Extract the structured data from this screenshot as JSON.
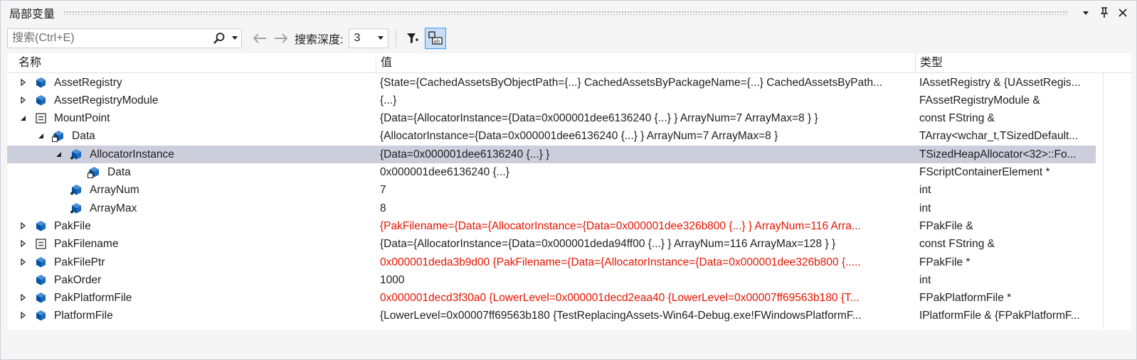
{
  "window": {
    "title": "局部变量"
  },
  "toolbar": {
    "search_placeholder": "搜索(Ctrl+E)",
    "depth_label": "搜索深度:",
    "depth_value": "3"
  },
  "columns": {
    "name": "名称",
    "value": "值",
    "type": "类型"
  },
  "rows": [
    {
      "name": "AssetRegistry",
      "value": "{State={CachedAssetsByObjectPath={...} CachedAssetsByPackageName={...} CachedAssetsByPath...",
      "type": "IAssetRegistry & {UAssetRegis...",
      "depth": 0,
      "expander": "collapsed",
      "icon": "class-member-icon",
      "value_red": false,
      "selected": false
    },
    {
      "name": "AssetRegistryModule",
      "value": "{...}",
      "type": "FAssetRegistryModule &",
      "depth": 0,
      "expander": "collapsed",
      "icon": "class-member-icon",
      "value_red": false,
      "selected": false
    },
    {
      "name": "MountPoint",
      "value": "{Data={AllocatorInstance={Data=0x000001dee6136240 {...} } ArrayNum=7 ArrayMax=8 } }",
      "type": "const FString &",
      "depth": 0,
      "expander": "expanded",
      "icon": "structure-icon",
      "value_red": false,
      "selected": false
    },
    {
      "name": "Data",
      "value": "{AllocatorInstance={Data=0x000001dee6136240 {...} } ArrayNum=7 ArrayMax=8 }",
      "type": "TArray<wchar_t,TSizedDefault...",
      "depth": 1,
      "expander": "expanded",
      "icon": "private-field-icon",
      "value_red": false,
      "selected": false
    },
    {
      "name": "AllocatorInstance",
      "value": "{Data=0x000001dee6136240 {...} }",
      "type": "TSizedHeapAllocator<32>::Fo...",
      "depth": 2,
      "expander": "expanded",
      "icon": "protected-field-icon",
      "value_red": false,
      "selected": true
    },
    {
      "name": "Data",
      "value": "0x000001dee6136240 {...}",
      "type": "FScriptContainerElement *",
      "depth": 3,
      "expander": "none",
      "icon": "private-field-icon",
      "value_red": false,
      "selected": false
    },
    {
      "name": "ArrayNum",
      "value": "7",
      "type": "int",
      "depth": 2,
      "expander": "none",
      "icon": "protected-field-icon",
      "value_red": false,
      "selected": false
    },
    {
      "name": "ArrayMax",
      "value": "8",
      "type": "int",
      "depth": 2,
      "expander": "none",
      "icon": "protected-field-icon",
      "value_red": false,
      "selected": false
    },
    {
      "name": "PakFile",
      "value": "{PakFilename={Data={AllocatorInstance={Data=0x000001dee326b800 {...} } ArrayNum=116 Arra...",
      "type": "FPakFile &",
      "depth": 0,
      "expander": "collapsed",
      "icon": "class-member-icon",
      "value_red": true,
      "selected": false
    },
    {
      "name": "PakFilename",
      "value": "{Data={AllocatorInstance={Data=0x000001deda94ff00 {...} } ArrayNum=116 ArrayMax=128 } }",
      "type": "const FString &",
      "depth": 0,
      "expander": "collapsed",
      "icon": "structure-icon",
      "value_red": false,
      "selected": false
    },
    {
      "name": "PakFilePtr",
      "value": "0x000001deda3b9d00 {PakFilename={Data={AllocatorInstance={Data=0x000001dee326b800 {.....",
      "type": "FPakFile *",
      "depth": 0,
      "expander": "collapsed",
      "icon": "class-member-icon",
      "value_red": true,
      "selected": false
    },
    {
      "name": "PakOrder",
      "value": "1000",
      "type": "int",
      "depth": 0,
      "expander": "none",
      "icon": "class-member-icon",
      "value_red": false,
      "selected": false
    },
    {
      "name": "PakPlatformFile",
      "value": "0x000001decd3f30a0 {LowerLevel=0x000001decd2eaa40 {LowerLevel=0x00007ff69563b180 {T...",
      "type": "FPakPlatformFile *",
      "depth": 0,
      "expander": "collapsed",
      "icon": "class-member-icon",
      "value_red": true,
      "selected": false
    },
    {
      "name": "PlatformFile",
      "value": "{LowerLevel=0x00007ff69563b180 {TestReplacingAssets-Win64-Debug.exe!FWindowsPlatformF...",
      "type": "IPlatformFile & {FPakPlatformF...",
      "depth": 0,
      "expander": "collapsed",
      "icon": "class-member-icon",
      "value_red": false,
      "selected": false
    }
  ],
  "colors": {
    "accent": "#3399ff",
    "changed_value": "#e51400",
    "selected_row": "#cccedb",
    "icon_blue": "#00539c"
  }
}
